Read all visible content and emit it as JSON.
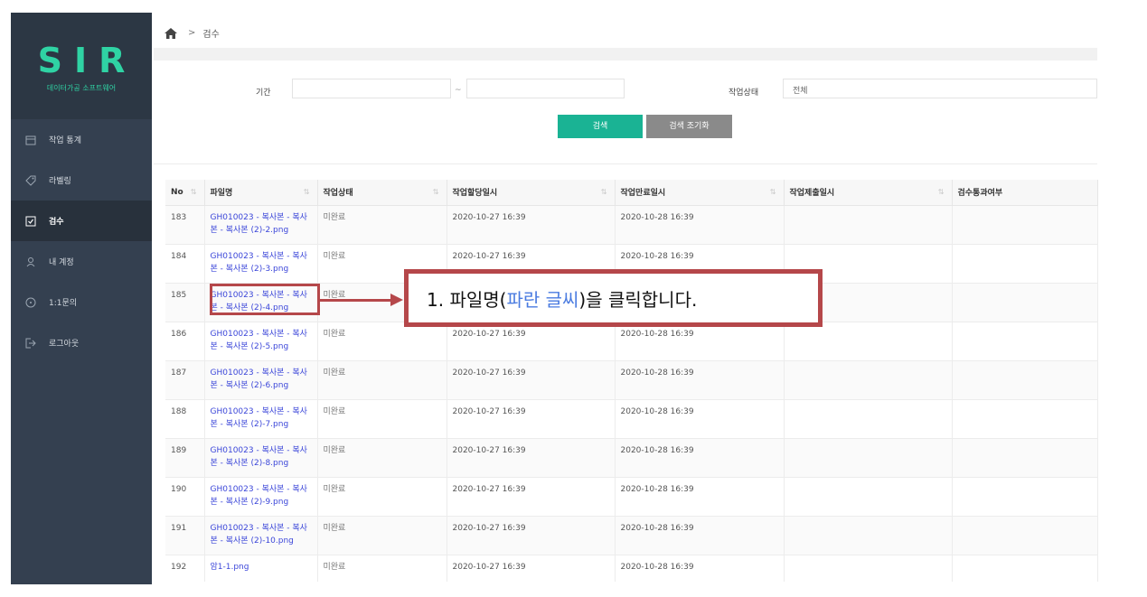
{
  "sidebar": {
    "logo": "SIR",
    "logo_sub": "데이터가공 소프트웨어",
    "items": [
      {
        "label": "작업 통계",
        "icon": "calendar-icon",
        "active": false
      },
      {
        "label": "라벨링",
        "icon": "tag-icon",
        "active": false
      },
      {
        "label": "검수",
        "icon": "checkbox-icon",
        "active": true
      },
      {
        "label": "내 계정",
        "icon": "user-icon",
        "active": false
      },
      {
        "label": "1:1문의",
        "icon": "chat-icon",
        "active": false
      },
      {
        "label": "로그아웃",
        "icon": "logout-icon",
        "active": false
      }
    ]
  },
  "breadcrumb": {
    "icon": "home-icon",
    "separator": ">",
    "current": "검수"
  },
  "search": {
    "period_label": "기간",
    "period_start": "",
    "period_sep": "~",
    "period_end": "",
    "status_label": "작업상태",
    "status_value": "전체",
    "search_button": "검색",
    "reset_button": "검색 조기화"
  },
  "table": {
    "headers": [
      "No",
      "파일명",
      "작업상태",
      "작업할당일시",
      "작업만료일시",
      "작업제출일시",
      "검수통과여부"
    ],
    "sort_glyph": "⇅",
    "rows": [
      {
        "no": "183",
        "file_l1": "GH010023 - 복사본 - 복사",
        "file_l2": "본 - 복사본 (2)-2.png",
        "status": "미완료",
        "assigned": "2020-10-27 16:39",
        "expires": "2020-10-28 16:39",
        "submitted": "",
        "passed": ""
      },
      {
        "no": "184",
        "file_l1": "GH010023 - 복사본 - 복사",
        "file_l2": "본 - 복사본 (2)-3.png",
        "status": "미완료",
        "assigned": "2020-10-27 16:39",
        "expires": "2020-10-28 16:39",
        "submitted": "",
        "passed": ""
      },
      {
        "no": "185",
        "file_l1": "GH010023 - 복사본 - 복사",
        "file_l2": "본 - 복사본 (2)-4.png",
        "status": "미완료",
        "assigned": "2020-10-27 16:39",
        "expires": "2020-10-28 16:39",
        "submitted": "",
        "passed": ""
      },
      {
        "no": "186",
        "file_l1": "GH010023 - 복사본 - 복사",
        "file_l2": "본 - 복사본 (2)-5.png",
        "status": "미완료",
        "assigned": "2020-10-27 16:39",
        "expires": "2020-10-28 16:39",
        "submitted": "",
        "passed": ""
      },
      {
        "no": "187",
        "file_l1": "GH010023 - 복사본 - 복사",
        "file_l2": "본 - 복사본 (2)-6.png",
        "status": "미완료",
        "assigned": "2020-10-27 16:39",
        "expires": "2020-10-28 16:39",
        "submitted": "",
        "passed": ""
      },
      {
        "no": "188",
        "file_l1": "GH010023 - 복사본 - 복사",
        "file_l2": "본 - 복사본 (2)-7.png",
        "status": "미완료",
        "assigned": "2020-10-27 16:39",
        "expires": "2020-10-28 16:39",
        "submitted": "",
        "passed": ""
      },
      {
        "no": "189",
        "file_l1": "GH010023 - 복사본 - 복사",
        "file_l2": "본 - 복사본 (2)-8.png",
        "status": "미완료",
        "assigned": "2020-10-27 16:39",
        "expires": "2020-10-28 16:39",
        "submitted": "",
        "passed": ""
      },
      {
        "no": "190",
        "file_l1": "GH010023 - 복사본 - 복사",
        "file_l2": "본 - 복사본 (2)-9.png",
        "status": "미완료",
        "assigned": "2020-10-27 16:39",
        "expires": "2020-10-28 16:39",
        "submitted": "",
        "passed": ""
      },
      {
        "no": "191",
        "file_l1": "GH010023 - 복사본 - 복사",
        "file_l2": "본 - 복사본 (2)-10.png",
        "status": "미완료",
        "assigned": "2020-10-27 16:39",
        "expires": "2020-10-28 16:39",
        "submitted": "",
        "passed": ""
      },
      {
        "no": "192",
        "file_l1": "암1-1.png",
        "file_l2": "",
        "status": "미완료",
        "assigned": "2020-10-27 16:39",
        "expires": "2020-10-28 16:39",
        "submitted": "",
        "passed": ""
      }
    ]
  },
  "annotation": {
    "prefix": "1. 파일명(",
    "highlight": "파란 글씨",
    "suffix": ")을 클릭합니다.",
    "color": "#b5474a",
    "highlight_color": "#4a7be0"
  },
  "colors": {
    "sidebar": "#344050",
    "accent": "#2fd3a4",
    "search_button": "#1ab394",
    "reset_button": "#8a8a8a",
    "link": "#3b46d9"
  }
}
